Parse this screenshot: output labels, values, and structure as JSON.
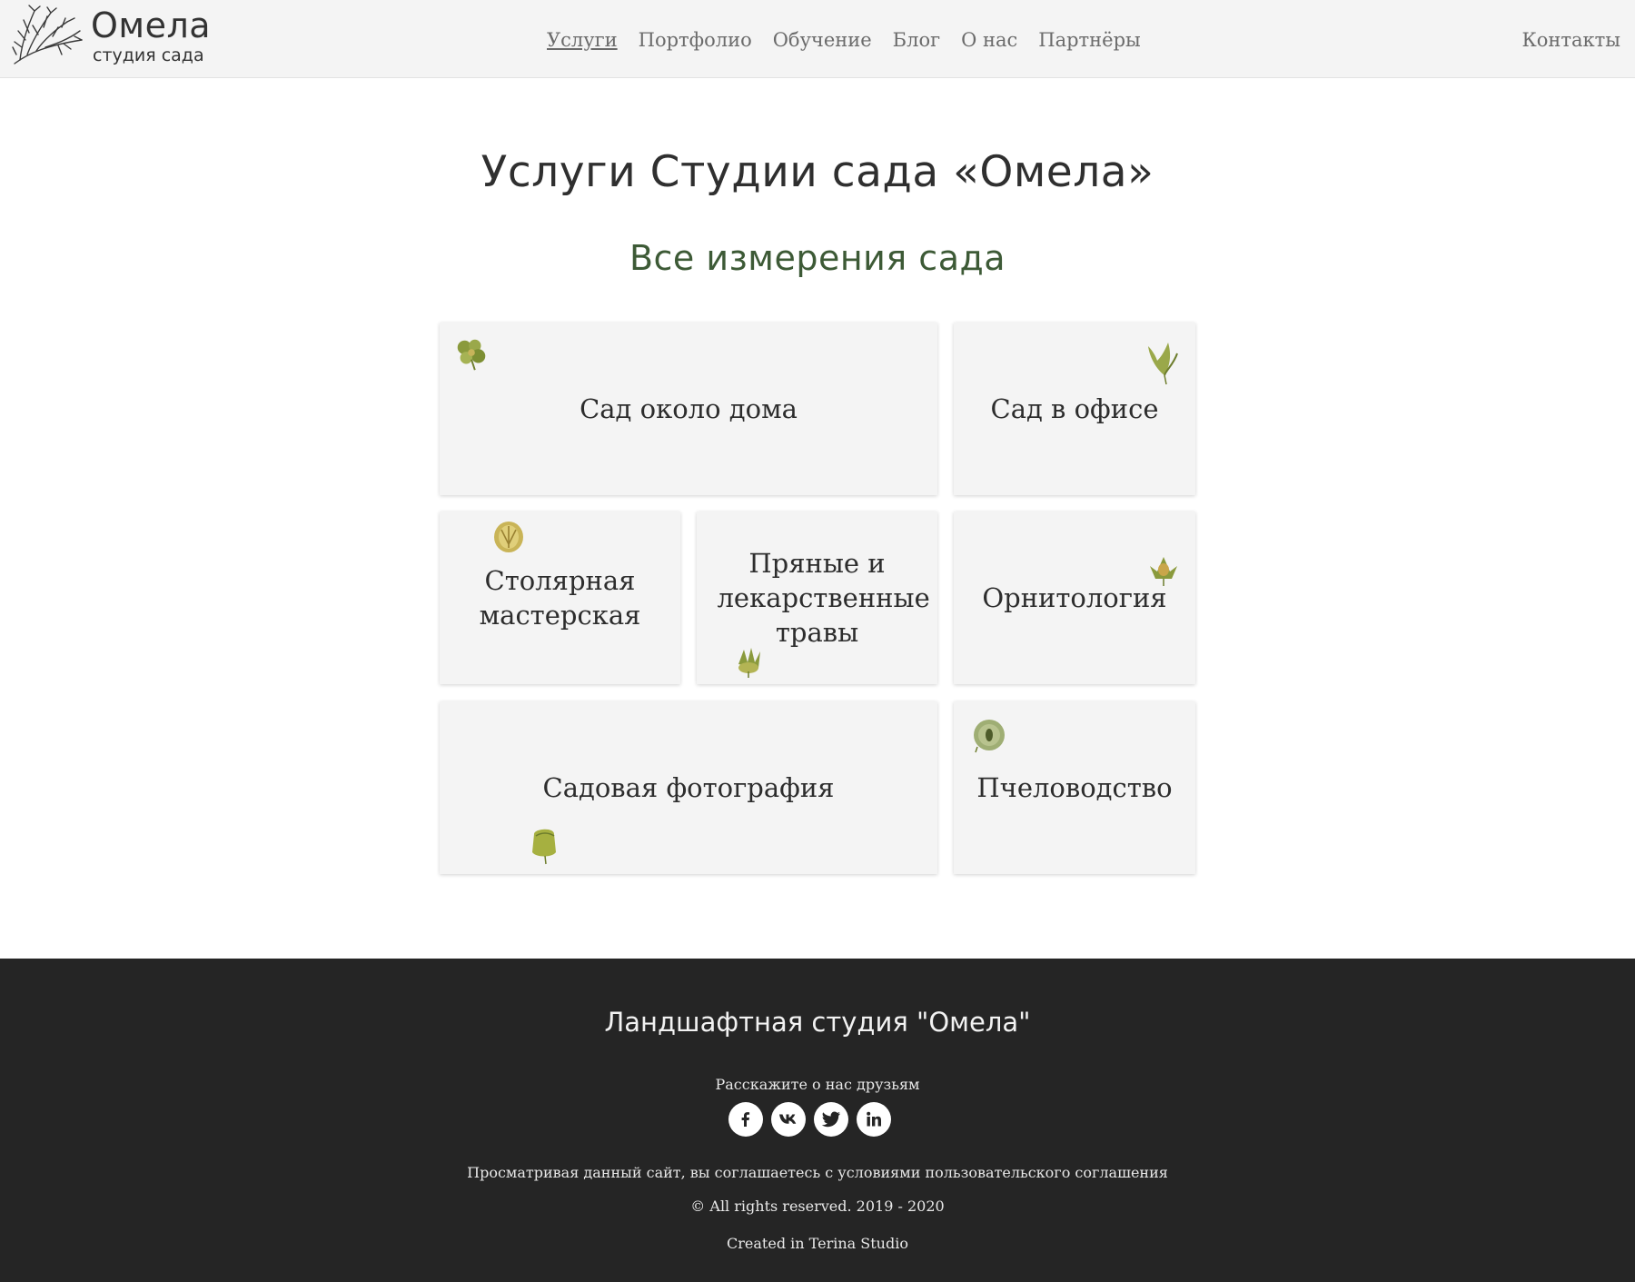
{
  "header": {
    "logo": {
      "title": "Омела",
      "subtitle": "студия сада"
    },
    "nav": [
      {
        "label": "Услуги",
        "active": true
      },
      {
        "label": "Портфолио"
      },
      {
        "label": "Обучение"
      },
      {
        "label": "Блог"
      },
      {
        "label": "О нас"
      },
      {
        "label": "Партнёры"
      }
    ],
    "contacts_label": "Контакты"
  },
  "main": {
    "title": "Услуги Студии сада «Омела»",
    "subtitle": "Все измерения сада",
    "services": [
      {
        "label": "Сад около дома",
        "icon": "flower-icon"
      },
      {
        "label": "Сад в офисе",
        "icon": "leaf-bud-icon"
      },
      {
        "label": "Столярная мастерская",
        "icon": "seed-pod-icon"
      },
      {
        "label": "Пряные и лекарственные травы",
        "icon": "herb-sprout-icon"
      },
      {
        "label": "Орнитология",
        "icon": "blossom-icon"
      },
      {
        "label": "Садовая фотография",
        "icon": "bud-icon"
      },
      {
        "label": "Пчеловодство",
        "icon": "seed-disc-icon"
      }
    ]
  },
  "footer": {
    "title": "Ландшафтная студия \"Омела\"",
    "share_text": "Расскажите о нас друзьям",
    "social": [
      "facebook-icon",
      "vk-icon",
      "twitter-icon",
      "linkedin-icon"
    ],
    "agreement": "Просматривая данный сайт, вы соглашаетесь с условиями пользовательского соглашения",
    "rights": "© All rights reserved. 2019 - 2020",
    "created": "Created in Terina Studio"
  },
  "colors": {
    "header_bg": "#f4f4f4",
    "card_bg": "#f4f4f4",
    "subtitle_green": "#3d5a36",
    "footer_bg": "#252525",
    "icon_green": "#8a9a3c"
  }
}
